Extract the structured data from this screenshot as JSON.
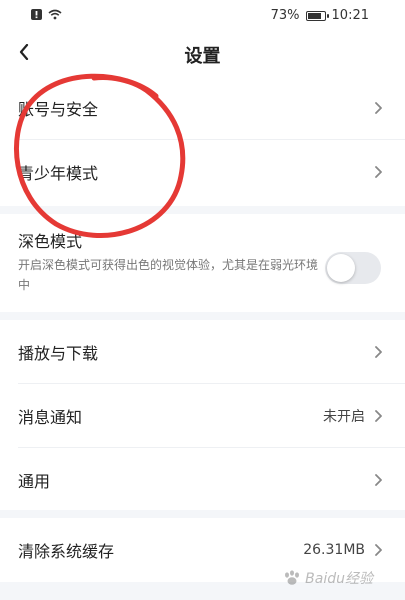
{
  "status_bar": {
    "battery_percent": "73%",
    "time": "10:21"
  },
  "header": {
    "title": "设置"
  },
  "sections": {
    "account": [
      {
        "label": "账号与安全"
      },
      {
        "label": "青少年模式"
      }
    ],
    "dark_mode": {
      "label": "深色模式",
      "desc": "开启深色模式可获得出色的视觉体验，尤其是在弱光环境中",
      "enabled": false
    },
    "general": [
      {
        "label": "播放与下载",
        "value": ""
      },
      {
        "label": "消息通知",
        "value": "未开启"
      },
      {
        "label": "通用",
        "value": ""
      }
    ],
    "cache": {
      "label": "清除系统缓存",
      "value": "26.31MB"
    }
  },
  "watermark": {
    "text": "Baidu经验"
  },
  "colors": {
    "annotation_red": "#e53935",
    "toggle_off": "#e7e9ed",
    "background": "#f4f6f9"
  }
}
